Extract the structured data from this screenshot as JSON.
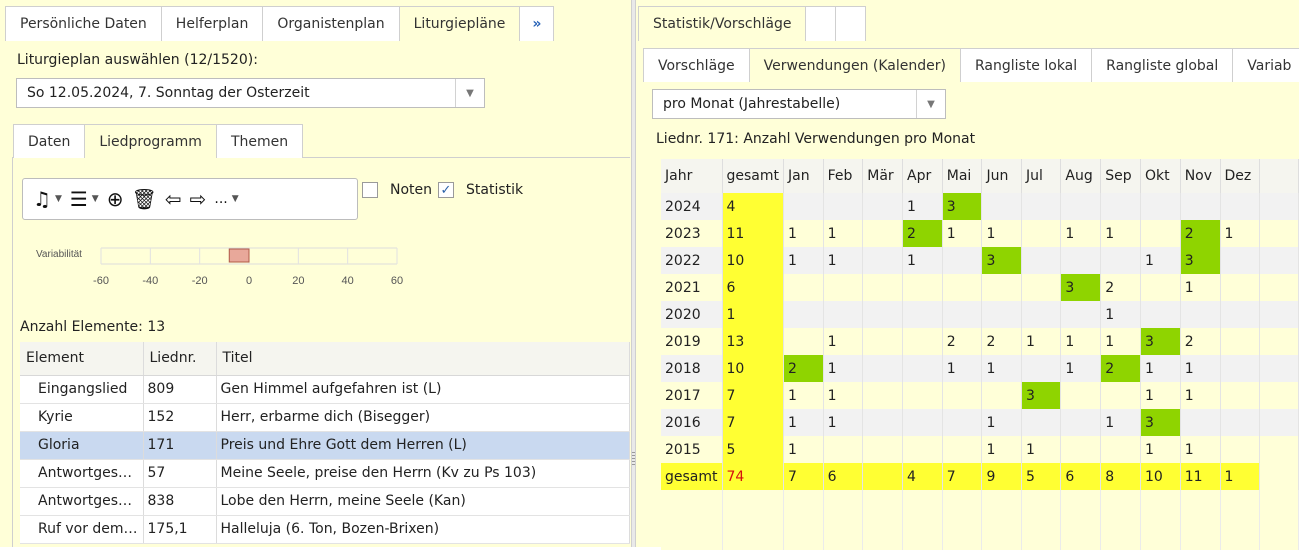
{
  "left": {
    "top_tabs": [
      "Persönliche Daten",
      "Helferplan",
      "Organistenplan",
      "Liturgiepläne"
    ],
    "more_tab": "»",
    "select_label": "Liturgieplan auswählen (12/1520):",
    "plan_select_value": "So 12.05.2024, 7. Sonntag der Osterzeit",
    "inner_tabs": [
      "Daten",
      "Liedprogramm",
      "Themen"
    ],
    "toolbar": {
      "music": "♫",
      "filter": "☰",
      "add": "⊕",
      "delete": "🗑",
      "prev": "⇦",
      "next": "⇨",
      "more": "...",
      "dropdown": "▼"
    },
    "noten_label": "Noten",
    "statistik_label": "Statistik",
    "statistik_checked": "✓",
    "variability": {
      "label": "Variabilität",
      "ticks": [
        "-60",
        "-40",
        "-20",
        "0",
        "20",
        "40",
        "60"
      ],
      "range": [
        -8,
        0
      ]
    },
    "count_label": "Anzahl Elemente: 13",
    "columns": [
      "Element",
      "Liednr.",
      "Titel"
    ],
    "rows": [
      {
        "element": "Eingangslied",
        "nr": "809",
        "title": "Gen Himmel aufgefahren ist (L)"
      },
      {
        "element": "Kyrie",
        "nr": "152",
        "title": "Herr, erbarme dich (Bisegger)"
      },
      {
        "element": "Gloria",
        "nr": "171",
        "title": "Preis und Ehre Gott dem Herren (L)"
      },
      {
        "element": "Antwortgesa...",
        "nr": "57",
        "title": "Meine Seele, preise den Herrn (Kv zu Ps 103)"
      },
      {
        "element": "Antwortgesa...",
        "nr": "838",
        "title": "Lobe den Herrn, meine Seele (Kan)"
      },
      {
        "element": "Ruf vor dem ...",
        "nr": "175,1",
        "title": "Halleluja (6. Ton, Bozen-Brixen)"
      }
    ],
    "selected_row": 2
  },
  "right": {
    "stat_tab": "Statistik/Vorschläge",
    "sub_tabs": [
      "Vorschläge",
      "Verwendungen (Kalender)",
      "Rangliste lokal",
      "Rangliste global",
      "Variab"
    ],
    "mode_select_value": "pro Monat (Jahrestabelle)",
    "caption": "Liednr. 171: Anzahl Verwendungen pro Monat",
    "header": [
      "Jahr",
      "gesamt",
      "Jan",
      "Feb",
      "Mär",
      "Apr",
      "Mai",
      "Jun",
      "Jul",
      "Aug",
      "Sep",
      "Okt",
      "Nov",
      "Dez"
    ],
    "rows": [
      {
        "cells": [
          "2024",
          "4",
          "",
          "",
          "",
          "1",
          "3",
          "",
          "",
          "",
          "",
          "",
          "",
          ""
        ],
        "max": [
          6
        ]
      },
      {
        "cells": [
          "2023",
          "11",
          "1",
          "1",
          "",
          "2",
          "1",
          "1",
          "",
          "1",
          "1",
          "",
          "2",
          "1"
        ],
        "max": [
          5,
          12
        ]
      },
      {
        "cells": [
          "2022",
          "10",
          "1",
          "1",
          "",
          "1",
          "",
          "3",
          "",
          "",
          "",
          "1",
          "3",
          ""
        ],
        "max": [
          7,
          12
        ]
      },
      {
        "cells": [
          "2021",
          "6",
          "",
          "",
          "",
          "",
          "",
          "",
          "",
          "3",
          "2",
          "",
          "1",
          ""
        ],
        "max": [
          9
        ]
      },
      {
        "cells": [
          "2020",
          "1",
          "",
          "",
          "",
          "",
          "",
          "",
          "",
          "",
          "1",
          "",
          "",
          ""
        ],
        "max": []
      },
      {
        "cells": [
          "2019",
          "13",
          "",
          "1",
          "",
          "",
          "2",
          "2",
          "1",
          "1",
          "1",
          "3",
          "2",
          ""
        ],
        "max": [
          11
        ]
      },
      {
        "cells": [
          "2018",
          "10",
          "2",
          "1",
          "",
          "",
          "1",
          "1",
          "",
          "1",
          "2",
          "1",
          "1",
          ""
        ],
        "max": [
          2,
          10
        ]
      },
      {
        "cells": [
          "2017",
          "7",
          "1",
          "1",
          "",
          "",
          "",
          "",
          "3",
          "",
          "",
          "1",
          "1",
          ""
        ],
        "max": [
          8
        ]
      },
      {
        "cells": [
          "2016",
          "7",
          "1",
          "1",
          "",
          "",
          "",
          "1",
          "",
          "",
          "1",
          "3",
          "",
          ""
        ],
        "max": [
          11
        ]
      },
      {
        "cells": [
          "2015",
          "5",
          "1",
          "",
          "",
          "",
          "",
          "1",
          "1",
          "",
          "",
          "1",
          "1",
          ""
        ],
        "max": []
      }
    ],
    "total_row": [
      "gesamt",
      "74",
      "7",
      "6",
      "",
      "4",
      "7",
      "9",
      "5",
      "6",
      "8",
      "10",
      "11",
      "1"
    ]
  },
  "colors": {
    "panel_bg": "#ffffd8",
    "total_yellow": "#ffff33",
    "max_green": "#8fd400",
    "selected_row": "#c9d9f0",
    "variability_bar": "#e8a89a"
  }
}
